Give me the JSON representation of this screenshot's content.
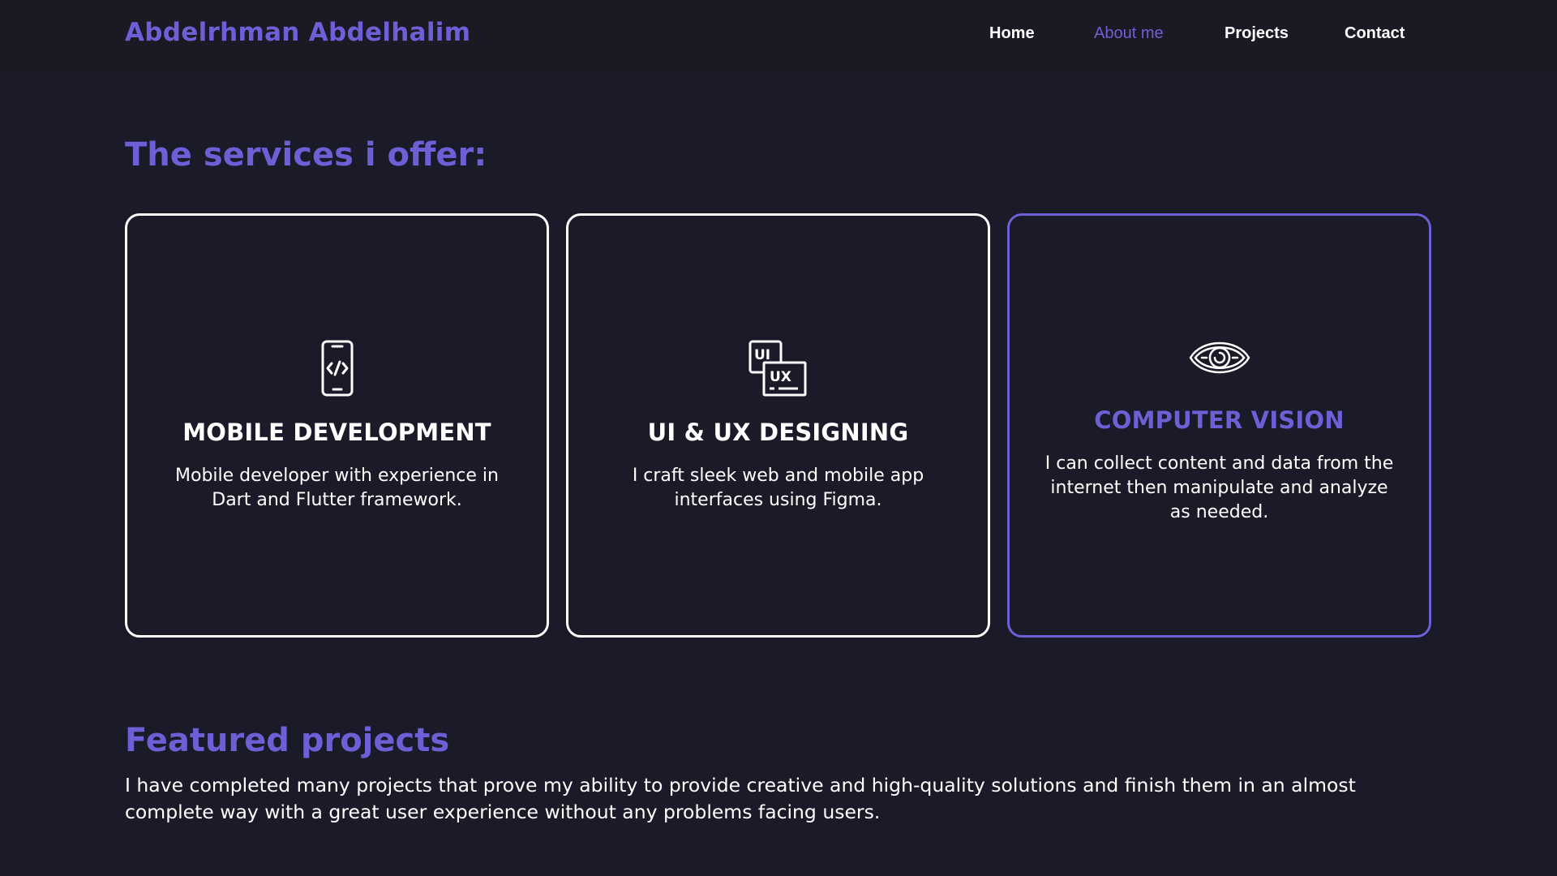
{
  "header": {
    "brand": "Abdelrhman Abdelhalim",
    "nav": [
      {
        "label": "Home",
        "active": false
      },
      {
        "label": "About me",
        "active": true
      },
      {
        "label": "Projects",
        "active": false
      },
      {
        "label": "Contact",
        "active": false
      }
    ]
  },
  "services": {
    "title": "The services i offer:",
    "cards": [
      {
        "icon": "mobile-code-icon",
        "title": "MOBILE DEVELOPMENT",
        "desc": "Mobile developer with experience in Dart and Flutter framework."
      },
      {
        "icon": "ui-ux-icon",
        "title": "UI & UX DESIGNING",
        "desc": "I craft sleek web and mobile app interfaces using Figma."
      },
      {
        "icon": "eye-icon",
        "title": "COMPUTER VISION",
        "desc": "I can collect content and data from the internet then manipulate and analyze as needed."
      }
    ]
  },
  "featured": {
    "title": "Featured projects",
    "desc": "I have completed many projects that prove my ability to provide creative and high-quality solutions and finish them in an almost complete way with a great user experience without any problems facing users."
  },
  "colors": {
    "accent": "#6f5fd6",
    "background": "#1b1a28",
    "navbar": "#1a1924",
    "text": "#ffffff"
  }
}
